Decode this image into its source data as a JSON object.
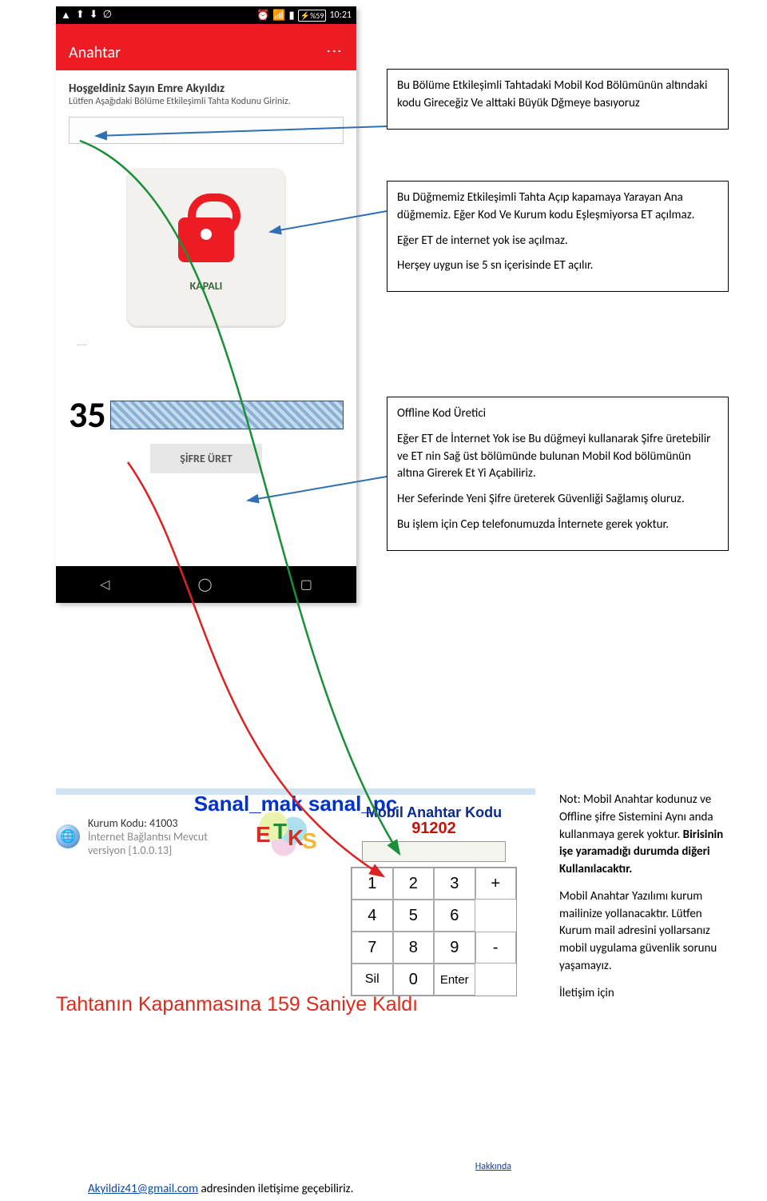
{
  "phone": {
    "status_time": "10:21",
    "battery": "%59",
    "app_title": "Anahtar",
    "welcome_heading": "Hoşgeldiniz Sayın Emre Akyıldız",
    "welcome_sub": "Lütfen Aşağıdaki Bölüme Etkileşimli Tahta Kodunu Giriniz.",
    "key_state_label": "KAPALI",
    "generated_code_prefix": "35",
    "sifre_button": "ŞİFRE ÜRET",
    "dots": "....."
  },
  "callouts": {
    "c1": "Bu Bölüme Etkileşimli Tahtadaki Mobil Kod Bölümünün altındaki kodu Gireceğiz Ve alttaki Büyük Dğmeye basıyoruz",
    "c2_p1": "Bu Düğmemiz Etkileşimli Tahta Açıp kapamaya Yarayan Ana düğmemiz. Eğer Kod Ve Kurum kodu Eşleşmiyorsa ET açılmaz.",
    "c2_p2": "Eğer ET de internet yok ise açılmaz.",
    "c2_p3": "Herşey uygun ise 5 sn içerisinde ET açılır.",
    "c3_title": "Offline Kod Üretici",
    "c3_p1": "Eğer ET de İnternet Yok ise Bu düğmeyi kullanarak Şifre üretebilir ve ET nin Sağ üst bölümünde bulunan Mobil Kod bölümünün altına Girerek Et Yi Açabiliriz.",
    "c3_p2": "Her Seferinde Yeni Şifre üreterek Güvenliği Sağlamış oluruz.",
    "c3_p3": "Bu işlem için Cep telefonumuzda İnternete gerek yoktur."
  },
  "section2": {
    "blue_title": "Sanal_mak sanal_pc",
    "kurum_label": "Kurum Kodu:",
    "kurum_value": "41003",
    "internet_label": "İnternet Bağlantısı Mevcut",
    "version_label": "versiyon [1.0.0.13]",
    "mak_title": "Mobil Anahtar Kodu",
    "mak_code": "91202",
    "keys": [
      "1",
      "2",
      "3",
      "4",
      "5",
      "6",
      "7",
      "8",
      "9",
      "Sil",
      "0",
      "Enter"
    ],
    "plus": "+",
    "minus": "-",
    "countdown_text": "Tahtanın Kapanmasına 159 Saniye Kaldı",
    "hakkinda": "Hakkında"
  },
  "note": {
    "p1": "Not: Mobil Anahtar kodunuz ve Offline şifre Sistemini Aynı anda kullanmaya gerek yoktur. ",
    "p1b": "Birisinin işe yaramadığı durumda diğeri Kullanılacaktır.",
    "p2": "Mobil Anahtar Yazılımı kurum mailinize yollanacaktır. Lütfen Kurum mail adresini yollarsanız mobil uygulama güvenlik sorunu yaşamayız.",
    "p3": "İletişim için"
  },
  "footer": {
    "email": "Akyildiz41@gmail.com",
    "rest": " adresinden iletişime geçebiliriz."
  }
}
